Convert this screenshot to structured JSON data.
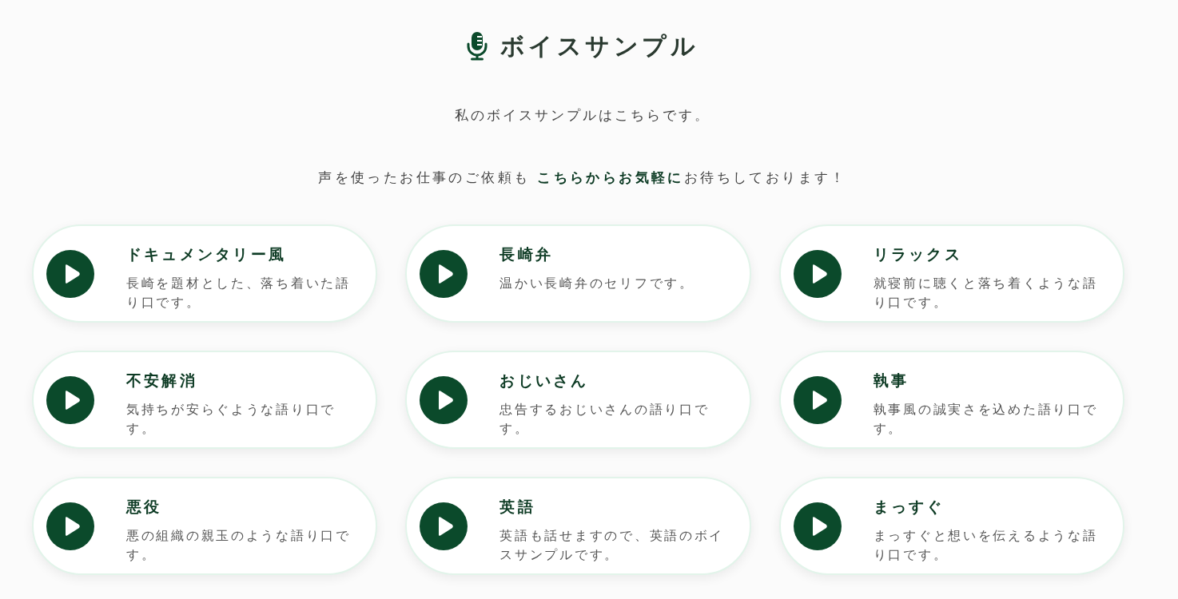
{
  "header": {
    "title": "ボイスサンプル"
  },
  "intro": {
    "text": "私のボイスサンプルはこちらです。"
  },
  "request": {
    "before": "声を使ったお仕事のご依頼も ",
    "link": "こちらからお気軽に",
    "after": "お待ちしております！"
  },
  "samples": [
    {
      "title": "ドキュメンタリー風",
      "description": "長崎を題材とした、落ち着いた語り口です。"
    },
    {
      "title": "長崎弁",
      "description": "温かい長崎弁のセリフです。"
    },
    {
      "title": "リラックス",
      "description": "就寝前に聴くと落ち着くような語り口です。"
    },
    {
      "title": "不安解消",
      "description": "気持ちが安らぐような語り口です。"
    },
    {
      "title": "おじいさん",
      "description": "忠告するおじいさんの語り口です。"
    },
    {
      "title": "執事",
      "description": "執事風の誠実さを込めた語り口です。"
    },
    {
      "title": "悪役",
      "description": "悪の組織の親玉のような語り口です。"
    },
    {
      "title": "英語",
      "description": "英語も話せますので、英語のボイスサンプルです。"
    },
    {
      "title": "まっすぐ",
      "description": "まっすぐと想いを伝えるような語り口です。"
    }
  ]
}
